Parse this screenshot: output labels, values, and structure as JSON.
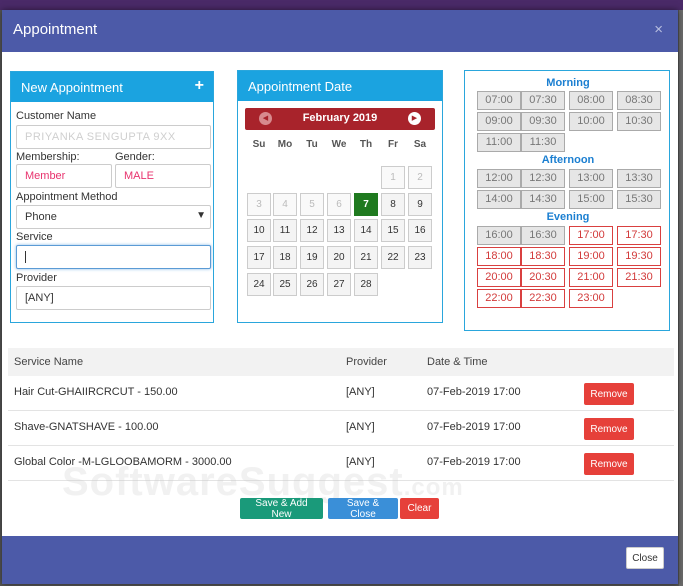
{
  "modal": {
    "title": "Appointment",
    "close_glyph": "×"
  },
  "new_appointment": {
    "heading": "New Appointment",
    "add_glyph": "+",
    "customer_name_label": "Customer Name",
    "customer_name_value": "PRIYANKA SENGUPTA  9XX",
    "membership_label": "Membership:",
    "membership_value": "Member",
    "gender_label": "Gender:",
    "gender_value": "MALE",
    "method_label": "Appointment Method",
    "method_value": "Phone",
    "service_label": "Service",
    "service_value": "",
    "provider_label": "Provider",
    "provider_value": "[ANY]"
  },
  "calendar": {
    "heading": "Appointment Date",
    "month": "February 2019",
    "weekdays": [
      "Su",
      "Mo",
      "Tu",
      "We",
      "Th",
      "Fr",
      "Sa"
    ],
    "days": [
      "1",
      "2",
      "3",
      "4",
      "5",
      "6",
      "7",
      "8",
      "9",
      "10",
      "11",
      "12",
      "13",
      "14",
      "15",
      "16",
      "17",
      "18",
      "19",
      "20",
      "21",
      "22",
      "23",
      "24",
      "25",
      "26",
      "27",
      "28"
    ],
    "selected_day": "7"
  },
  "time_slots": {
    "morning_label": "Morning",
    "morning": [
      "07:00",
      "07:30",
      "08:00",
      "08:30",
      "09:00",
      "09:30",
      "10:00",
      "10:30",
      "11:00",
      "11:30"
    ],
    "afternoon_label": "Afternoon",
    "afternoon": [
      "12:00",
      "12:30",
      "13:00",
      "13:30",
      "14:00",
      "14:30",
      "15:00",
      "15:30"
    ],
    "evening_label": "Evening",
    "evening": [
      "16:00",
      "16:30",
      "17:00",
      "17:30",
      "18:00",
      "18:30",
      "19:00",
      "19:30",
      "20:00",
      "20:30",
      "21:00",
      "21:30",
      "22:00",
      "22:30",
      "23:00"
    ],
    "available_color": "#d23a3a"
  },
  "services_table": {
    "headers": {
      "service": "Service Name",
      "provider": "Provider",
      "datetime": "Date & Time"
    },
    "rows": [
      {
        "service": "Hair Cut-GHAIIRCRCUT - 150.00",
        "provider": "[ANY]",
        "datetime": "07-Feb-2019 17:00",
        "action": "Remove"
      },
      {
        "service": "Shave-GNATSHAVE - 100.00",
        "provider": "[ANY]",
        "datetime": "07-Feb-2019 17:00",
        "action": "Remove"
      },
      {
        "service": "Global Color -M-LGLOOBAMORM - 3000.00",
        "provider": "[ANY]",
        "datetime": "07-Feb-2019 17:00",
        "action": "Remove"
      }
    ]
  },
  "actions": {
    "save_add_new": "Save & Add New",
    "save_close": "Save & Close",
    "clear": "Clear",
    "close": "Close"
  },
  "watermark": {
    "text": "SoftwareSuggest",
    "suffix": ".com"
  },
  "colors": {
    "header_bg": "#4c5aa8",
    "panel_accent": "#1ba3e0",
    "calendar_bar": "#a8232b",
    "today": "#1f7a1f",
    "remove": "#e6403a",
    "save_add_new": "#1a9a7a",
    "save_close": "#3a8fd8"
  }
}
